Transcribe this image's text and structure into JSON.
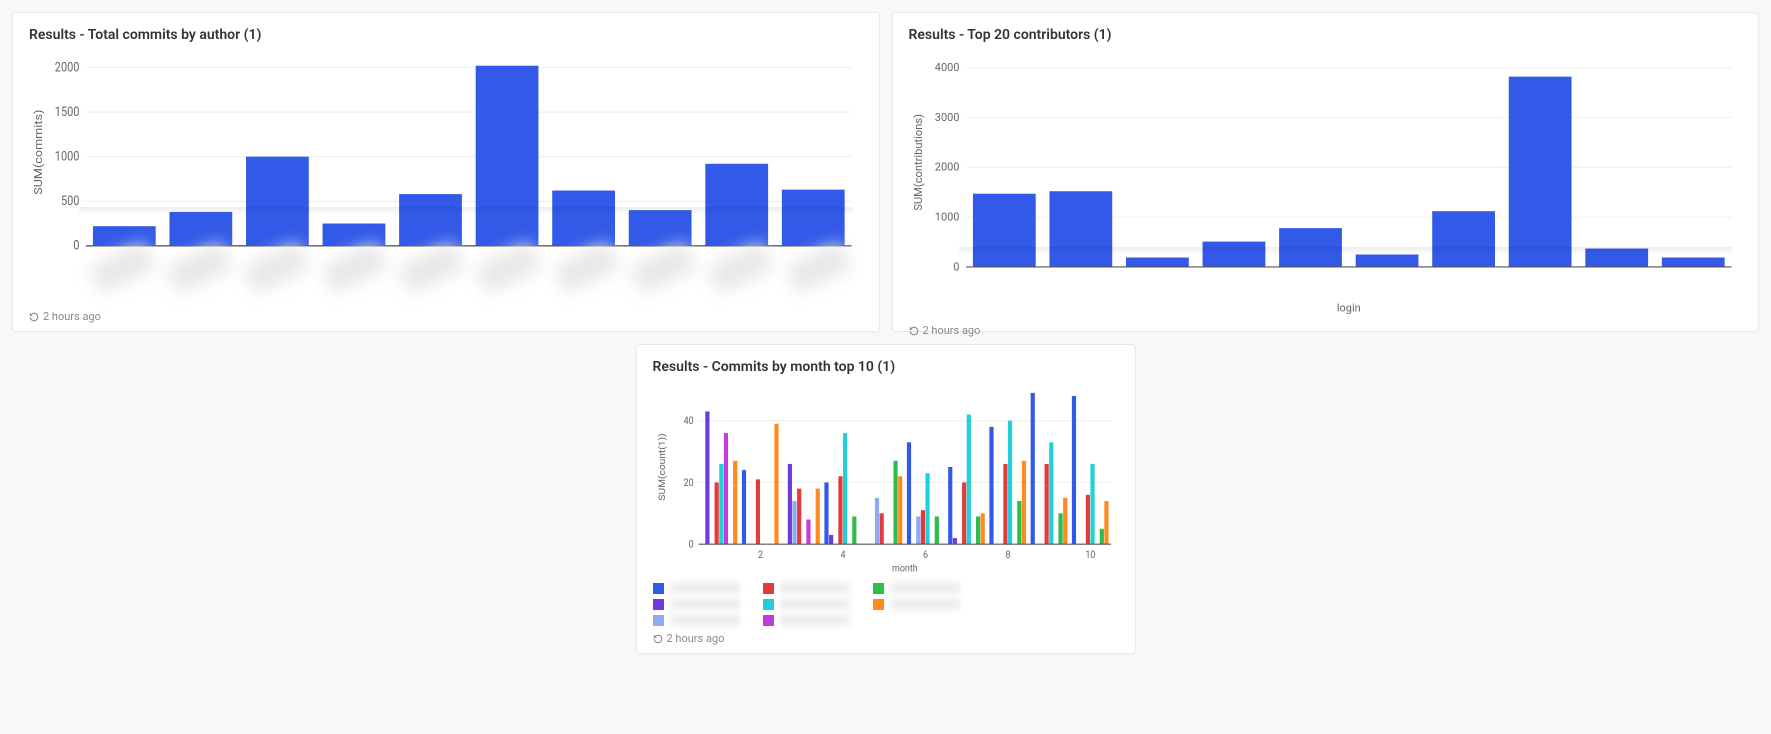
{
  "cards": {
    "commits_by_author": {
      "title": "Results - Total commits by author (1)",
      "ylabel": "SUM(commits)",
      "footer": "2 hours ago"
    },
    "top_contributors": {
      "title": "Results - Top 20 contributors (1)",
      "ylabel": "SUM(contributions)",
      "xlabel": "login",
      "footer": "2 hours ago"
    },
    "commits_by_month": {
      "title": "Results - Commits by month top 10 (1)",
      "ylabel": "SUM(count(1))",
      "xlabel": "month",
      "footer": "2 hours ago"
    }
  },
  "chart_data": [
    {
      "id": "commits_by_author",
      "type": "bar",
      "categories": [
        "a1",
        "a2",
        "a3",
        "a4",
        "a5",
        "a6",
        "a7",
        "a8",
        "a9",
        "a10"
      ],
      "categories_obscured": true,
      "values": [
        220,
        380,
        1000,
        250,
        580,
        2020,
        620,
        400,
        920,
        630
      ],
      "ylabel": "SUM(commits)",
      "ylim": [
        0,
        2100
      ],
      "yticks": [
        0,
        500,
        1000,
        1500,
        2000
      ],
      "color": "#3259e8",
      "x_labels_visible": false
    },
    {
      "id": "top_contributors",
      "type": "bar",
      "categories": [
        "c1",
        "c2",
        "c3",
        "c4",
        "c5",
        "c6",
        "c7",
        "c8",
        "c9",
        "c10"
      ],
      "categories_obscured": true,
      "values": [
        1470,
        1520,
        190,
        510,
        780,
        250,
        1120,
        3820,
        370,
        190
      ],
      "ylabel": "SUM(contributions)",
      "xlabel": "login",
      "ylim": [
        0,
        4200
      ],
      "yticks": [
        0,
        1000,
        2000,
        3000,
        4000
      ],
      "color": "#3259e8",
      "x_labels_visible": false
    },
    {
      "id": "commits_by_month",
      "type": "bar",
      "x": [
        1,
        2,
        3,
        4,
        5,
        6,
        7,
        8,
        9,
        10
      ],
      "series": [
        {
          "name": "s1",
          "color": "#3259e8",
          "values": [
            0,
            24,
            0,
            20,
            0,
            33,
            25,
            38,
            49,
            48
          ]
        },
        {
          "name": "s2",
          "color": "#6f3bdc",
          "values": [
            43,
            0,
            26,
            3,
            0,
            0,
            2,
            0,
            0,
            0
          ]
        },
        {
          "name": "s3",
          "color": "#8fa8f7",
          "values": [
            0,
            0,
            14,
            0,
            15,
            9,
            0,
            0,
            0,
            0
          ]
        },
        {
          "name": "s4",
          "color": "#e13b3b",
          "values": [
            20,
            21,
            18,
            22,
            10,
            11,
            20,
            26,
            26,
            16
          ]
        },
        {
          "name": "s5",
          "color": "#1fd0d9",
          "values": [
            26,
            0,
            0,
            36,
            0,
            23,
            42,
            40,
            33,
            26
          ]
        },
        {
          "name": "s6",
          "color": "#c23bdc",
          "values": [
            36,
            0,
            8,
            0,
            0,
            0,
            0,
            0,
            0,
            0
          ]
        },
        {
          "name": "s7",
          "color": "#2fbd4a",
          "values": [
            0,
            0,
            0,
            9,
            27,
            9,
            9,
            14,
            10,
            5
          ]
        },
        {
          "name": "s8",
          "color": "#ff8a1f",
          "values": [
            27,
            39,
            18,
            0,
            22,
            0,
            10,
            27,
            15,
            14
          ]
        }
      ],
      "series_names_obscured": true,
      "ylabel": "SUM(count(1))",
      "xlabel": "month",
      "ylim": [
        0,
        50
      ],
      "yticks": [
        0,
        20,
        40
      ],
      "xticks": [
        2,
        4,
        6,
        8,
        10
      ]
    }
  ]
}
